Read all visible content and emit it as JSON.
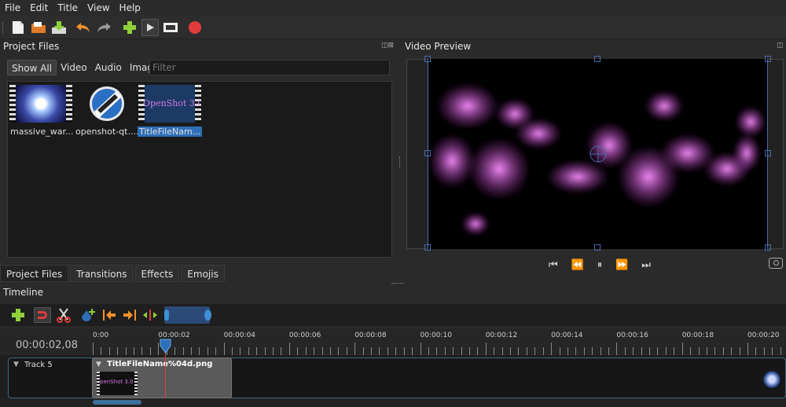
{
  "menu": [
    "File",
    "Edit",
    "Title",
    "View",
    "Help"
  ],
  "project_files": {
    "title": "Project Files",
    "filters": [
      "Show All",
      "Video",
      "Audio",
      "Image"
    ],
    "filter_placeholder": "Filter",
    "files": [
      {
        "name": "massive_war..."
      },
      {
        "name": "openshot-qt...."
      },
      {
        "name": "TitleFileNam...",
        "thumb_text": "OpenShot 3.0"
      }
    ]
  },
  "bottom_tabs": [
    "Project Files",
    "Transitions",
    "Effects",
    "Emojis"
  ],
  "video_preview": {
    "title": "Video Preview"
  },
  "timeline": {
    "title": "Timeline",
    "timecode": "00:00:02,08",
    "ticks": [
      "0:00",
      "00:00:02",
      "00:00:04",
      "00:00:06",
      "00:00:08",
      "00:00:10",
      "00:00:12",
      "00:00:14",
      "00:00:16",
      "00:00:18",
      "00:00:20"
    ],
    "track_name": "Track 5",
    "clip_name": "TitleFileName%04d.png",
    "clip_thumb_text": "penShot 3.0"
  },
  "colors": {
    "accent": "#3d8fd8",
    "record": "#e23b3b",
    "add": "#8fd13b",
    "undo": "#f2902c",
    "selection": "#2f6fb7",
    "nebula": "#e06ee8"
  }
}
